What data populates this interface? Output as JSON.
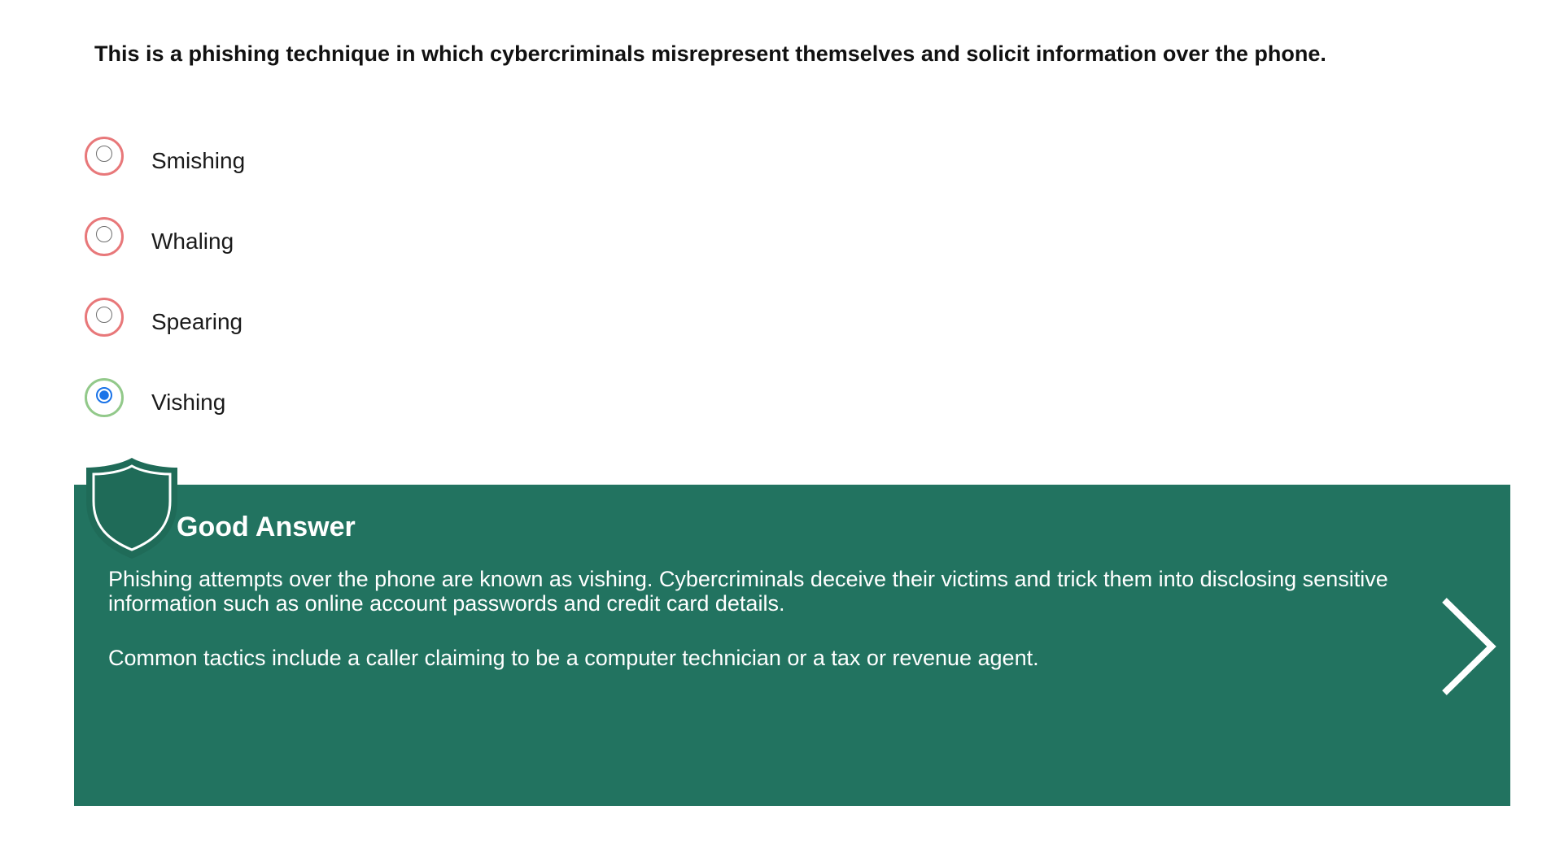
{
  "question": {
    "text": "This is a phishing technique in which cybercriminals misrepresent themselves and solicit information over the phone."
  },
  "options": [
    {
      "label": "Smishing",
      "selected": false,
      "correct": false
    },
    {
      "label": "Whaling",
      "selected": false,
      "correct": false
    },
    {
      "label": "Spearing",
      "selected": false,
      "correct": false
    },
    {
      "label": "Vishing",
      "selected": true,
      "correct": true
    }
  ],
  "feedback": {
    "title": "Good Answer",
    "paragraphs": [
      "Phishing attempts over the phone are known as vishing. Cybercriminals deceive their victims and trick them into disclosing sensitive information such as online account passwords and credit card details.",
      "Common tactics include a caller claiming to be a computer technician or a tax or revenue agent."
    ],
    "icon": "shield-icon",
    "next_icon": "chevron-right-icon"
  },
  "colors": {
    "feedback_background": "#227360",
    "incorrect_ring": "#e8787a",
    "correct_ring": "#92c98a",
    "radio_checked": "#1a73e8",
    "text": "#111111"
  }
}
